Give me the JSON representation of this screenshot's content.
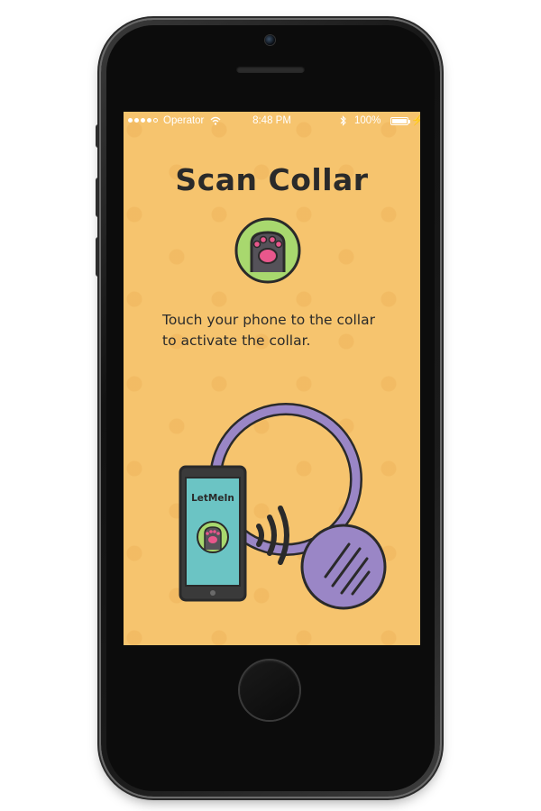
{
  "status_bar": {
    "carrier": "Operator",
    "time": "8:48 PM",
    "battery": "100%"
  },
  "screen": {
    "title": "Scan Collar",
    "instruction": "Touch your phone to the collar to activate the collar."
  },
  "illustration": {
    "app_name": "LetMeIn"
  },
  "colors": {
    "background": "#f6c46e",
    "collar": "#9a86c6",
    "badge_green": "#a8d86e",
    "paw_pink": "#e8578c",
    "mini_screen": "#6bc4c4",
    "ink": "#2a2a2a"
  },
  "icons": [
    "wifi-icon",
    "bluetooth-icon",
    "battery-icon",
    "charge-icon",
    "paw-icon",
    "nfc-waves-icon"
  ]
}
